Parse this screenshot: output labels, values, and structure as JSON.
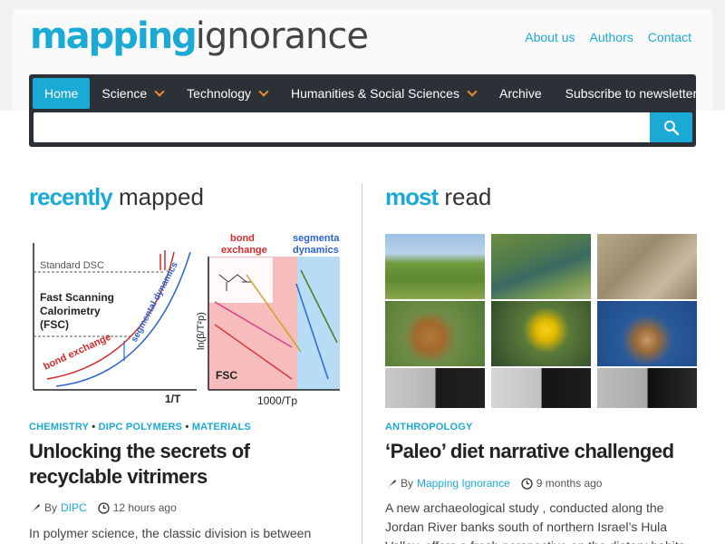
{
  "site": {
    "logo_part1": "mapping",
    "logo_part2": "ignorance",
    "top_links": [
      "About us",
      "Authors",
      "Contact"
    ]
  },
  "nav": {
    "items": [
      {
        "label": "Home",
        "active": true,
        "dropdown": false
      },
      {
        "label": "Science",
        "active": false,
        "dropdown": true
      },
      {
        "label": "Technology",
        "active": false,
        "dropdown": true
      },
      {
        "label": "Humanities & Social Sciences",
        "active": false,
        "dropdown": true
      },
      {
        "label": "Archive",
        "active": false,
        "dropdown": false
      },
      {
        "label": "Subscribe to newsletter",
        "active": false,
        "dropdown": false
      }
    ],
    "search_value": "",
    "search_icon": "search-icon"
  },
  "recent": {
    "title_bold": "recently",
    "title_normal": " mapped",
    "categories": [
      "CHEMISTRY",
      "DIPC POLYMERS",
      "MATERIALS"
    ],
    "article_title": "Unlocking the secrets of recyclable vitrimers",
    "by": "By",
    "author": "DIPC",
    "time": "12 hours ago",
    "excerpt": "In polymer science, the classic division is between",
    "figure": {
      "standard_dsc": "Standard DSC",
      "fsc_line1": "Fast Scanning",
      "fsc_line2": "Calorimetry",
      "fsc_line3": "(FSC)",
      "bond_exchange": "bond exchange",
      "segmental": "segmental dynamics",
      "x_left": "1/T",
      "y_right": "ln(β/T²p)",
      "fsc_label": "FSC",
      "x_right": "1000/Tp",
      "bond_exchange_right_1": "bond",
      "bond_exchange_right_2": "exchange",
      "segmental_right_1": "segmenta",
      "segmental_right_2": "dynamics"
    }
  },
  "most": {
    "title_bold": "most",
    "title_normal": " read",
    "categories": [
      "ANTHROPOLOGY"
    ],
    "article_title": "‘Paleo’ diet narrative challenged",
    "by": "By",
    "author": "Mapping Ignorance",
    "time": "9 months ago",
    "excerpt_line1": "A new archaeological study , conducted along the",
    "excerpt_line2": "Jordan River banks south of northern Israel’s Hula",
    "excerpt_line3": "Valley, offers a fresh perspective on the dietary habits"
  },
  "colors": {
    "accent": "#1ba9d6",
    "nav_bg": "#2b3137",
    "chevron": "#e88f2e"
  }
}
